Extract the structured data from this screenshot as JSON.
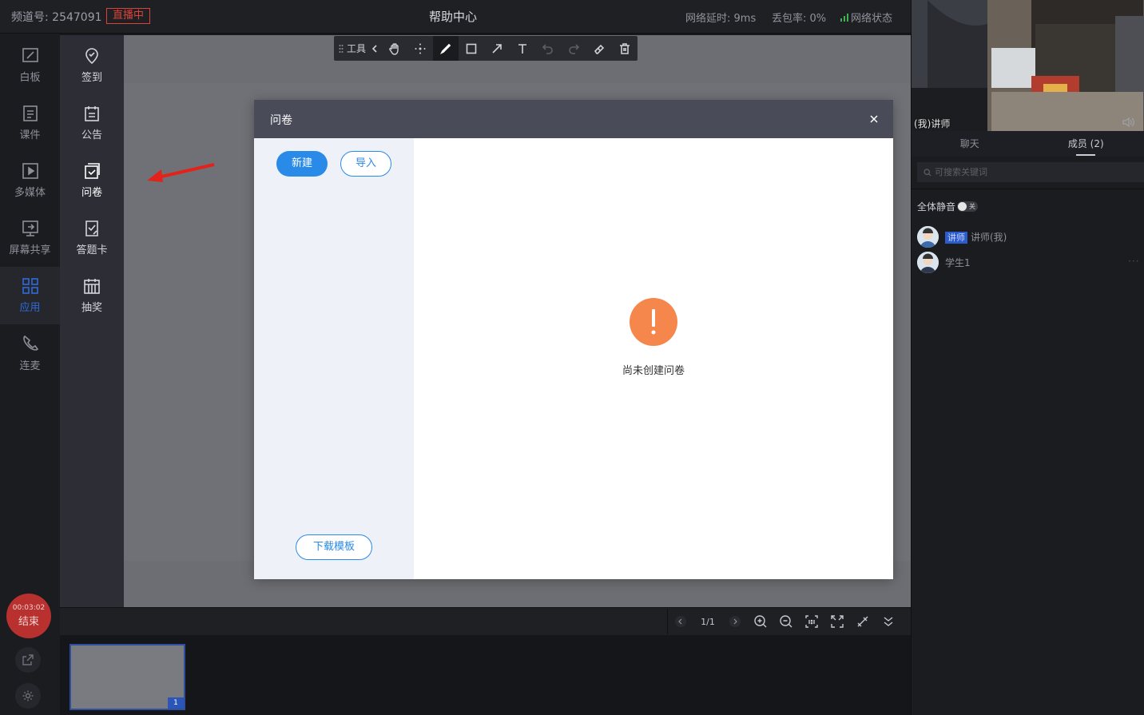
{
  "topbar": {
    "channel": "频道号: 2547091",
    "live_badge": "直播中",
    "help_center": "帮助中心",
    "net_delay": "网络延时: 9ms",
    "loss_rate": "丢包率: 0%",
    "net_status": "网络状态",
    "net_status_color": "#3fb34f",
    "live_color": "#d9433a"
  },
  "leftnav": {
    "items": [
      {
        "label": "白板",
        "icon": "whiteboard-icon"
      },
      {
        "label": "课件",
        "icon": "courseware-icon"
      },
      {
        "label": "多媒体",
        "icon": "multimedia-icon"
      },
      {
        "label": "屏幕共享",
        "icon": "screen-share-icon"
      },
      {
        "label": "应用",
        "icon": "apps-icon",
        "active": true
      },
      {
        "label": "连麦",
        "icon": "phone-icon"
      }
    ],
    "end_time": "00:03:02",
    "end_label": "结束",
    "accent": "#2f6bd8"
  },
  "apps": {
    "items": [
      {
        "label": "签到",
        "icon": "checkin-icon"
      },
      {
        "label": "公告",
        "icon": "notice-icon"
      },
      {
        "label": "问卷",
        "icon": "questionnaire-icon"
      },
      {
        "label": "答题卡",
        "icon": "answer-card-icon"
      },
      {
        "label": "抽奖",
        "icon": "lottery-icon"
      }
    ]
  },
  "toolbar": {
    "label": "工具",
    "tools": [
      "collapse-icon",
      "hand-icon",
      "move-icon",
      "pen-icon",
      "rectangle-icon",
      "arrow-icon",
      "text-icon",
      "undo-icon",
      "redo-icon",
      "eraser-icon",
      "trash-icon"
    ]
  },
  "pagebar": {
    "page": "1/1",
    "tools": [
      "prev-page-icon",
      "next-page-icon",
      "zoom-in-icon",
      "zoom-out-icon",
      "actual-size-icon",
      "fullscreen-icon",
      "annotate-icon",
      "collapse-down-icon"
    ]
  },
  "thumbnail": {
    "number": "1"
  },
  "modal": {
    "title": "问卷",
    "new_button": "新建",
    "import_button": "导入",
    "template_button": "下载模板",
    "empty_text": "尚未创建问卷",
    "primary_color": "#2a8ae8",
    "warn_color": "#f5874d"
  },
  "right": {
    "video_label": "(我)讲师",
    "tabs": [
      {
        "label": "聊天"
      },
      {
        "label": "成员 (2)",
        "active": true
      }
    ],
    "search_placeholder": "可搜索关键词",
    "mute_all": "全体静音",
    "mute_toggle": "关",
    "members": [
      {
        "role": "讲师",
        "name": "讲师(我)"
      },
      {
        "name": "学生1"
      }
    ],
    "more": "···"
  }
}
